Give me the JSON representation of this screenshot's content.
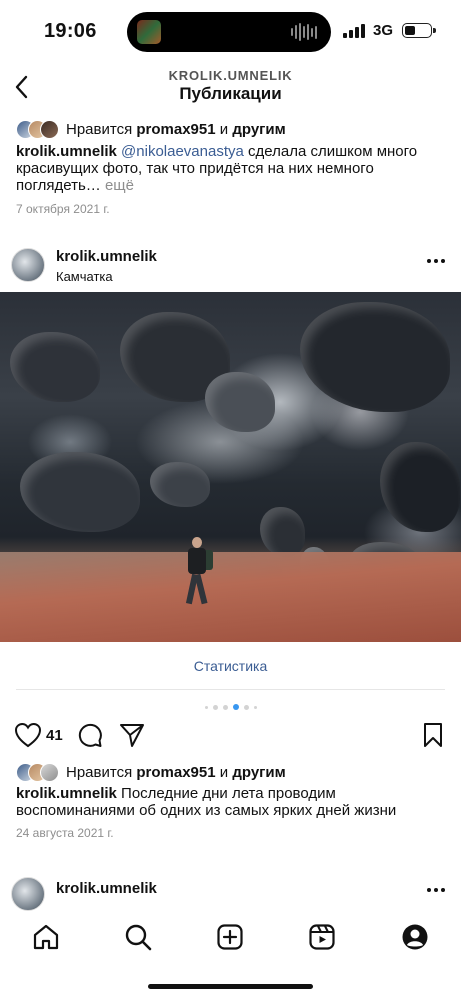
{
  "status": {
    "time": "19:06",
    "network": "3G",
    "battery_level": 0.35
  },
  "header": {
    "username": "KROLIK.UMNELIK",
    "title": "Публикации"
  },
  "prev_post": {
    "likes_prefix": "Нравится",
    "likes_user": "promax951",
    "likes_and": "и",
    "likes_others": "другим",
    "caption_user": "krolik.umnelik",
    "caption_mention": "@nikolaevanastya",
    "caption_text": "сделала слишком много красивущих фото, так что придётся на них немного поглядеть…",
    "caption_more": "ещё",
    "date": "7 октября 2021 г."
  },
  "post": {
    "username": "krolik.umnelik",
    "location": "Камчатка",
    "stats_label": "Статистика",
    "likes_count": "41",
    "carousel_active": 3,
    "likes_prefix": "Нравится",
    "likes_user": "promax951",
    "likes_and": "и",
    "likes_others": "другим",
    "caption_user": "krolik.umnelik",
    "caption_text": "Последние дни лета проводим воспоминаниями об одних из самых ярких дней жизни",
    "date": "24 августа 2021 г."
  },
  "next_post": {
    "username": "krolik.umnelik"
  },
  "tabs": [
    "home-icon",
    "search-icon",
    "create-icon",
    "reels-icon",
    "profile-icon"
  ],
  "colors": {
    "link": "#3b5d93",
    "carousel_active": "#3897f0",
    "meta": "#8e8e8e"
  }
}
